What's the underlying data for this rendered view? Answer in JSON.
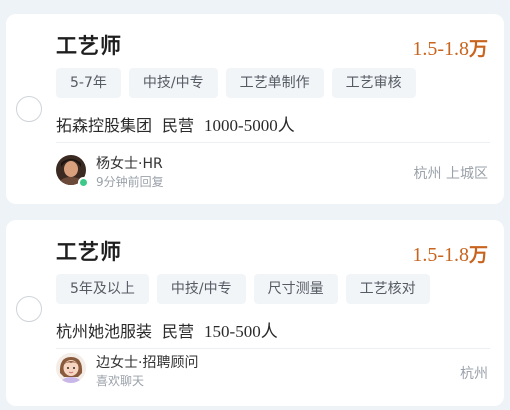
{
  "jobs": [
    {
      "title": "工艺师",
      "salary_range": "1.5-1.8",
      "salary_unit": "万",
      "tags": [
        "5-7年",
        "中技/中专",
        "工艺单制作",
        "工艺审核"
      ],
      "company": "拓森控股集团",
      "company_type": "民营",
      "company_size": "1000-5000人",
      "recruiter": "杨女士·HR",
      "activity": "9分钟前回复",
      "location": "杭州 上城区",
      "online": true
    },
    {
      "title": "工艺师",
      "salary_range": "1.5-1.8",
      "salary_unit": "万",
      "tags": [
        "5年及以上",
        "中技/中专",
        "尺寸测量",
        "工艺核对"
      ],
      "company": "杭州她池服装",
      "company_type": "民营",
      "company_size": "150-500人",
      "recruiter": "边女士·招聘顾问",
      "activity": "喜欢聊天",
      "location": "杭州",
      "online": false
    }
  ],
  "colors": {
    "salary": "#c8641e",
    "online_dot": "#3cc98a",
    "tag_bg": "#f2f5f8",
    "page_bg": "#eef3f8"
  }
}
